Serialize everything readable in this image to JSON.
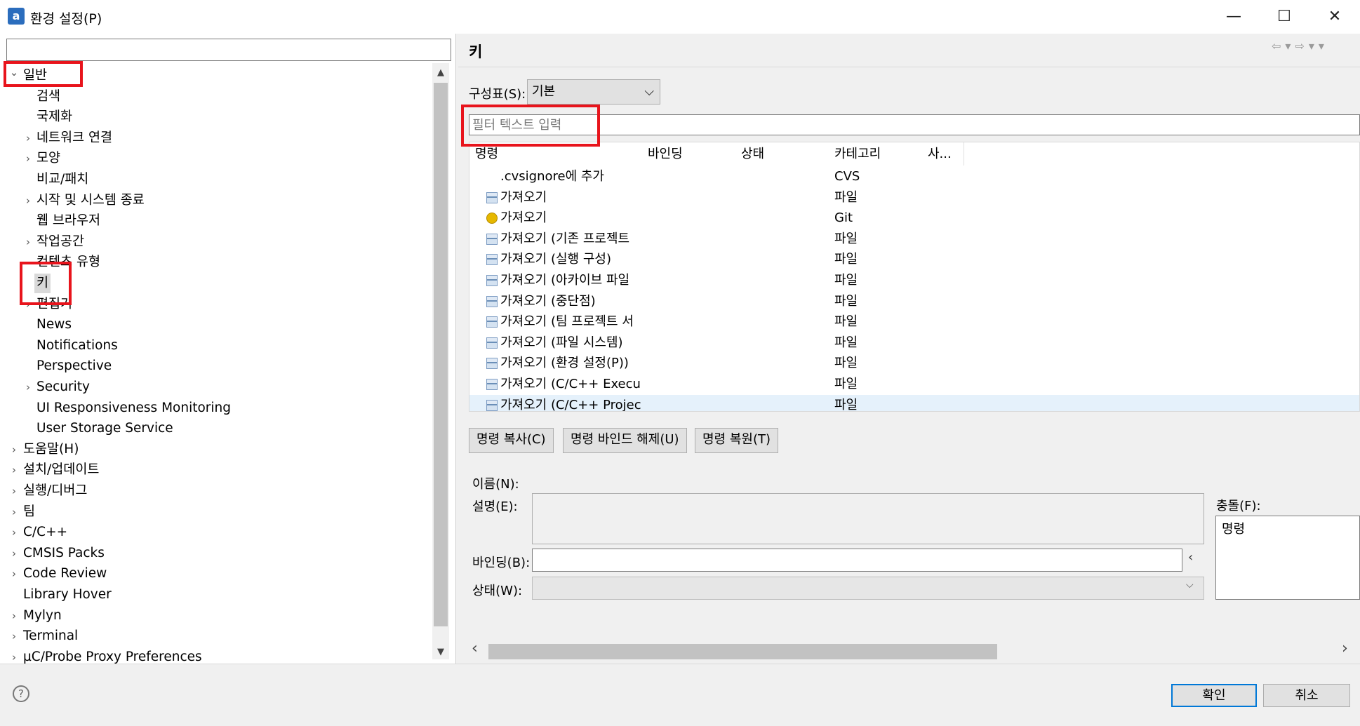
{
  "window": {
    "title": "환경 설정(P)",
    "icon_name": "app-icon",
    "minimize_glyph": "—",
    "maximize_glyph": "☐",
    "close_glyph": "✕"
  },
  "tree": {
    "filter_value": "",
    "items": [
      {
        "label": "일반",
        "expanded": true,
        "has_children": true
      },
      {
        "label": "검색"
      },
      {
        "label": "국제화"
      },
      {
        "label": "네트워크 연결",
        "has_children": true
      },
      {
        "label": "모양",
        "has_children": true
      },
      {
        "label": "비교/패치"
      },
      {
        "label": "시작 및 시스템 종료",
        "has_children": true
      },
      {
        "label": "웹 브라우저"
      },
      {
        "label": "작업공간",
        "has_children": true
      },
      {
        "label": "컨텐츠 유형"
      },
      {
        "label": "키",
        "selected": true
      },
      {
        "label": "편집기",
        "has_children": true
      },
      {
        "label": "News"
      },
      {
        "label": "Notifications"
      },
      {
        "label": "Perspective"
      },
      {
        "label": "Security",
        "has_children": true
      },
      {
        "label": "UI Responsiveness Monitoring"
      },
      {
        "label": "User Storage Service"
      },
      {
        "label": "도움말(H)",
        "has_children": true
      },
      {
        "label": "설치/업데이트",
        "has_children": true
      },
      {
        "label": "실행/디버그",
        "has_children": true
      },
      {
        "label": "팀",
        "has_children": true
      },
      {
        "label": "C/C++",
        "has_children": true
      },
      {
        "label": "CMSIS Packs",
        "has_children": true
      },
      {
        "label": "Code Review",
        "has_children": true
      },
      {
        "label": "Library Hover"
      },
      {
        "label": "Mylyn",
        "has_children": true
      },
      {
        "label": "Terminal",
        "has_children": true
      },
      {
        "label": "µC/Probe Proxy Preferences",
        "has_children": true
      }
    ]
  },
  "page": {
    "title": "키",
    "nav": {
      "back": "⇦",
      "back_menu": "▾",
      "forward": "⇨",
      "forward_menu": "▾",
      "view_menu": "▾"
    },
    "scheme": {
      "label": "구성표(S):",
      "value": "기본"
    },
    "filter": {
      "placeholder": "필터 텍스트 입력",
      "value": ""
    },
    "table": {
      "columns": [
        "명령",
        "바인딩",
        "상태",
        "카테고리",
        "사..."
      ],
      "rows": [
        {
          "command": ".cvsignore에 추가",
          "binding": "",
          "state": "",
          "category": "CVS",
          "icon": "none"
        },
        {
          "command": "가져오기",
          "binding": "",
          "state": "",
          "category": "파일",
          "icon": "import-icon"
        },
        {
          "command": "가져오기",
          "binding": "",
          "state": "",
          "category": "Git",
          "icon": "git-icon"
        },
        {
          "command": "가져오기 (기존 프로젝트",
          "binding": "",
          "state": "",
          "category": "파일",
          "icon": "import-icon"
        },
        {
          "command": "가져오기 (실행 구성)",
          "binding": "",
          "state": "",
          "category": "파일",
          "icon": "import-icon"
        },
        {
          "command": "가져오기 (아카이브 파일",
          "binding": "",
          "state": "",
          "category": "파일",
          "icon": "import-icon"
        },
        {
          "command": "가져오기 (중단점)",
          "binding": "",
          "state": "",
          "category": "파일",
          "icon": "import-icon"
        },
        {
          "command": "가져오기 (팀 프로젝트 서",
          "binding": "",
          "state": "",
          "category": "파일",
          "icon": "import-icon"
        },
        {
          "command": "가져오기 (파일 시스템)",
          "binding": "",
          "state": "",
          "category": "파일",
          "icon": "import-icon"
        },
        {
          "command": "가져오기 (환경 설정(P))",
          "binding": "",
          "state": "",
          "category": "파일",
          "icon": "import-icon"
        },
        {
          "command": "가져오기 (C/C++ Execut",
          "binding": "",
          "state": "",
          "category": "파일",
          "icon": "import-icon"
        },
        {
          "command": "가져오기 (C/C++ Project",
          "binding": "",
          "state": "",
          "category": "파일",
          "icon": "import-icon"
        }
      ]
    },
    "buttons": {
      "copy": "명령 복사(C)",
      "unbind": "명령 바인드 해제(U)",
      "restore": "명령 복원(T)"
    },
    "details": {
      "name_label": "이름(N):",
      "description_label": "설명(E):",
      "binding_label": "바인딩(B):",
      "binding_value": "",
      "binding_arrow": "‹",
      "state_label": "상태(W):",
      "state_value": "",
      "conflicts_label": "충돌(F):",
      "conflicts_header": "명령"
    },
    "hscroll": {
      "left": "‹",
      "right": "›"
    }
  },
  "footer": {
    "help_glyph": "?",
    "ok": "확인",
    "cancel": "취소"
  },
  "colors": {
    "annotation_red": "#e8141c",
    "accent_blue": "#0078d7"
  }
}
